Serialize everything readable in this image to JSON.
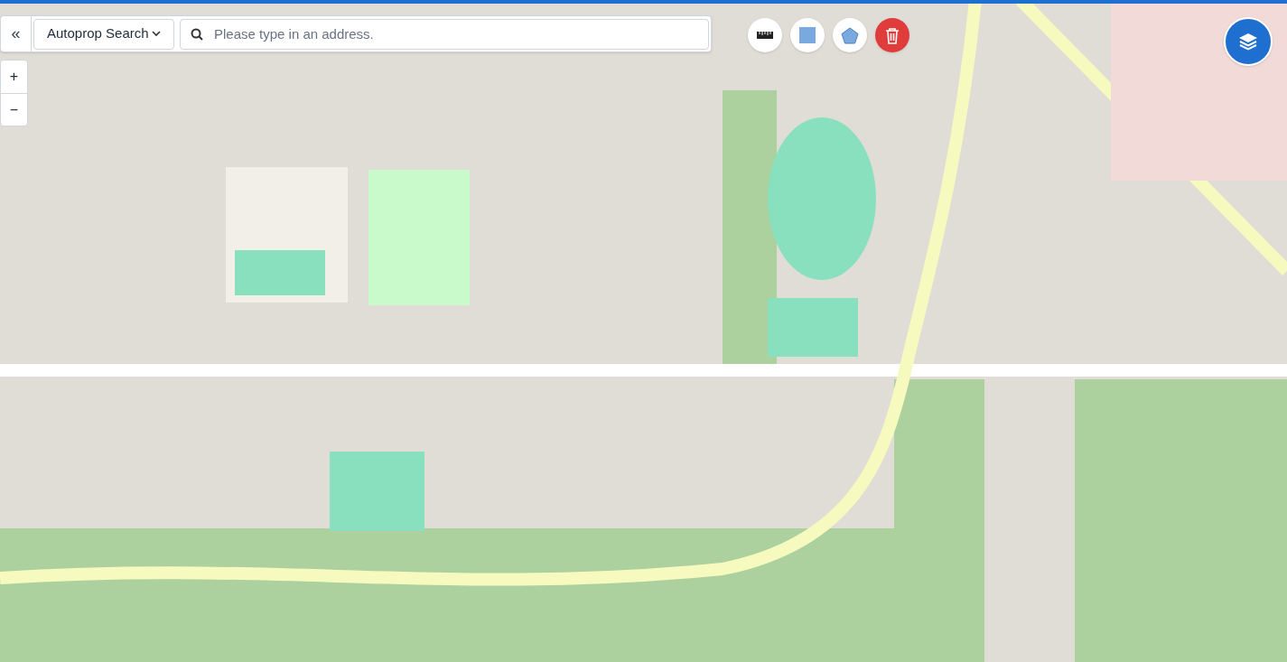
{
  "search": {
    "collapse": "«",
    "mode": "Autoprop Search",
    "placeholder": "Please type in an address."
  },
  "zoom": [
    "+",
    "−"
  ],
  "tools": [
    {
      "kind": "ruler"
    },
    {
      "kind": "square"
    },
    {
      "kind": "polygon"
    },
    {
      "kind": "delete"
    }
  ],
  "layers": {
    "kind": "layers"
  }
}
